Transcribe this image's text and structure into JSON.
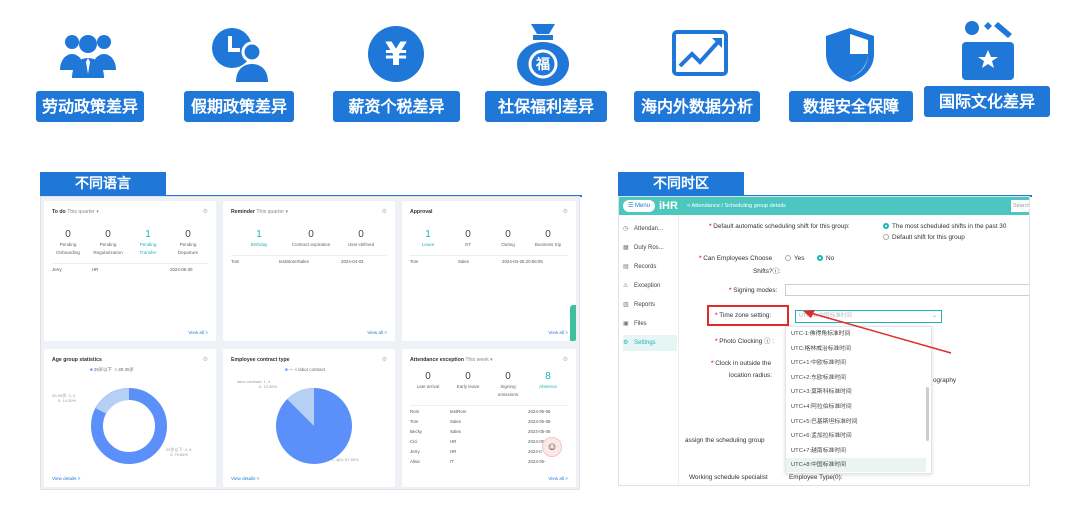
{
  "banner": {
    "items": [
      {
        "label": "劳动政策差异",
        "icon": "people-group-icon"
      },
      {
        "label": "假期政策差异",
        "icon": "clock-person-icon"
      },
      {
        "label": "薪资个税差异",
        "icon": "yen-icon"
      },
      {
        "label": "社保福利差异",
        "icon": "money-bag-icon"
      },
      {
        "label": "海内外数据分析",
        "icon": "trend-chart-icon"
      },
      {
        "label": "数据安全保障",
        "icon": "shield-icon"
      },
      {
        "label": "国际文化差异",
        "icon": "culture-gift-icon"
      }
    ],
    "accent": "#1f78d8"
  },
  "left_panel": {
    "tag": "不同语言",
    "todo": {
      "title": "To do",
      "filter": "This quarter",
      "stats": [
        {
          "n": "0",
          "l1": "Pending",
          "l2": "Onboarding"
        },
        {
          "n": "0",
          "l1": "Pending",
          "l2": "Regularization"
        },
        {
          "n": "1",
          "l1": "Pending",
          "l2": "Transfer"
        },
        {
          "n": "0",
          "l1": "Pending",
          "l2": "Departure"
        }
      ],
      "rows": [
        {
          "name": "Jerry",
          "dept": "HR",
          "date": "2024-05-30"
        }
      ],
      "view_all": "View all >"
    },
    "reminder": {
      "title": "Reminder",
      "filter": "This quarter",
      "stats": [
        {
          "n": "1",
          "l1": "Birthday"
        },
        {
          "n": "0",
          "l1": "Contract expiration"
        },
        {
          "n": "0",
          "l1": "User-defined"
        }
      ],
      "rows": [
        {
          "name": "Tom",
          "dept": "testStore/Sales",
          "date": "2024-04-03"
        }
      ],
      "view_all": "View all >"
    },
    "approval": {
      "title": "Approval",
      "stats": [
        {
          "n": "1",
          "l1": "Leave"
        },
        {
          "n": "0",
          "l1": "OT"
        },
        {
          "n": "0",
          "l1": "Outing"
        },
        {
          "n": "0",
          "l1": "Business trip"
        }
      ],
      "rows": [
        {
          "name": "Tom",
          "dept": "Sales",
          "date": "2024-04-25 20:56:05"
        }
      ],
      "view_all": "View all >"
    },
    "age": {
      "title": "Age group statistics",
      "legend": [
        "25岁以下",
        "30-35岁"
      ],
      "label_a": "30-35岁: 2, 2",
      "label_a2": "0: 14.29%",
      "label_b": "25岁以下: 4, 8",
      "label_b2": "0: 75.86%",
      "view": "View details >"
    },
    "contract": {
      "title": "Employee contract type",
      "legend": [
        "—",
        "labor contract"
      ],
      "label_a": "labor contract: 1, 0",
      "label_a2": "0: 12.50%",
      "label_b": "—: 7, 4(0): 87.50%",
      "view": "View details >"
    },
    "exception": {
      "title": "Attendance exception",
      "filter": "This week",
      "stats": [
        {
          "n": "0",
          "l1": "Late arrival"
        },
        {
          "n": "0",
          "l1": "Early leave"
        },
        {
          "n": "0",
          "l1": "Signing",
          "l2": "omissions"
        },
        {
          "n": "8",
          "l1": "Absence"
        }
      ],
      "rows": [
        {
          "name": "Rom",
          "dept": "testRom",
          "date": "2024-05-06"
        },
        {
          "name": "Tom",
          "dept": "Sales",
          "date": "2024-05-06"
        },
        {
          "name": "Becky",
          "dept": "Sales",
          "date": "2024-05-06"
        },
        {
          "name": "Cici",
          "dept": "HR",
          "date": "2024-05-"
        },
        {
          "name": "Jerry",
          "dept": "HR",
          "date": "2024-0"
        },
        {
          "name": "Alisa",
          "dept": "IT",
          "date": "2024-05-"
        }
      ],
      "view_all": "View all >"
    }
  },
  "right_panel": {
    "tag": "不同时区",
    "menu": "Menu",
    "logo": "iHR",
    "breadcrumb": "<   Attendance  /  Scheduling group details",
    "search": "Search",
    "sidebar": [
      {
        "label": "Attendan...",
        "icon": "clock-icon"
      },
      {
        "label": "Duty Ros...",
        "icon": "calendar-icon"
      },
      {
        "label": "Records",
        "icon": "document-icon"
      },
      {
        "label": "Exception",
        "icon": "warning-icon"
      },
      {
        "label": "Reports",
        "icon": "chart-icon"
      },
      {
        "label": "Files",
        "icon": "folder-icon"
      },
      {
        "label": "Settings",
        "icon": "gear-icon"
      }
    ],
    "form": {
      "default_shift_label": "Default automatic scheduling shift for this group:",
      "default_shift_opt1": "The most scheduled shifts in the past 30",
      "default_shift_opt2": "Default shift for this group",
      "choose_shift_label": "Can Employees Choose",
      "choose_shift_label2": "Shifts?ⓘ:",
      "yes": "Yes",
      "no": "No",
      "signing_label": "Signing modes:",
      "tz_label": "Time zone setting:",
      "tz_placeholder": "UTC+8:中国标准时间",
      "photo_label": "Photo Clocking ⓘ :",
      "clock_label": "Clock in outside the",
      "clock_label2": "location radius:",
      "photography_text": "ography",
      "assign_label": "assign the scheduling group",
      "specialist_label": "Working schedule specialist",
      "employee_type": "Employee Type(0):"
    },
    "tz_options": [
      "UTC-1:佛得角标准时间",
      "UTC:格林威治标准时间",
      "UTC+1:中欧标准时间",
      "UTC+2:东欧标准时间",
      "UTC+3:莫斯科标准时间",
      "UTC+4:阿拉伯标准时间",
      "UTC+5:巴基斯坦标准时间",
      "UTC+6:孟加拉标准时间",
      "UTC+7:越南标准时间",
      "UTC+8:中国标准时间"
    ],
    "selected_tz": "UTC+8:中国标准时间",
    "colors": {
      "teal": "#4cc7bf",
      "annotation_red": "#e02b2b"
    }
  }
}
